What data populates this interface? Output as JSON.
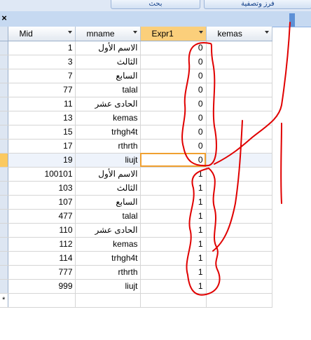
{
  "ribbon": {
    "btn_left": "بحث",
    "btn_right": "فرز وتصفية"
  },
  "tab": {
    "close_glyph": "×"
  },
  "columns": [
    "Mid",
    "mname",
    "Expr1",
    "kemas"
  ],
  "rows": [
    {
      "mid": "1",
      "mname": "الاسم الأول",
      "expr1": "0",
      "kemas": ""
    },
    {
      "mid": "3",
      "mname": "الثالث",
      "expr1": "0",
      "kemas": ""
    },
    {
      "mid": "7",
      "mname": "السابع",
      "expr1": "0",
      "kemas": ""
    },
    {
      "mid": "77",
      "mname": "talal",
      "expr1": "0",
      "kemas": ""
    },
    {
      "mid": "11",
      "mname": "الحادى عشر",
      "expr1": "0",
      "kemas": ""
    },
    {
      "mid": "13",
      "mname": "kemas",
      "expr1": "0",
      "kemas": ""
    },
    {
      "mid": "15",
      "mname": "trhgh4t",
      "expr1": "0",
      "kemas": ""
    },
    {
      "mid": "17",
      "mname": "rthrth",
      "expr1": "0",
      "kemas": ""
    },
    {
      "mid": "19",
      "mname": "liujt",
      "expr1": "0",
      "kemas": ""
    },
    {
      "mid": "100101",
      "mname": "الاسم الأول",
      "expr1": "1",
      "kemas": ""
    },
    {
      "mid": "103",
      "mname": "الثالث",
      "expr1": "1",
      "kemas": ""
    },
    {
      "mid": "107",
      "mname": "السابع",
      "expr1": "1",
      "kemas": ""
    },
    {
      "mid": "477",
      "mname": "talal",
      "expr1": "1",
      "kemas": ""
    },
    {
      "mid": "110",
      "mname": "الحادى عشر",
      "expr1": "1",
      "kemas": ""
    },
    {
      "mid": "112",
      "mname": "kemas",
      "expr1": "1",
      "kemas": ""
    },
    {
      "mid": "114",
      "mname": "trhgh4t",
      "expr1": "1",
      "kemas": ""
    },
    {
      "mid": "777",
      "mname": "rthrth",
      "expr1": "1",
      "kemas": ""
    },
    {
      "mid": "999",
      "mname": "liujt",
      "expr1": "1",
      "kemas": ""
    }
  ],
  "new_row_marker": "*",
  "current_row": 8,
  "colors": {
    "header_selected": "#fbcf7b",
    "ink": "#e00000",
    "ribbon_text": "#15428b"
  }
}
